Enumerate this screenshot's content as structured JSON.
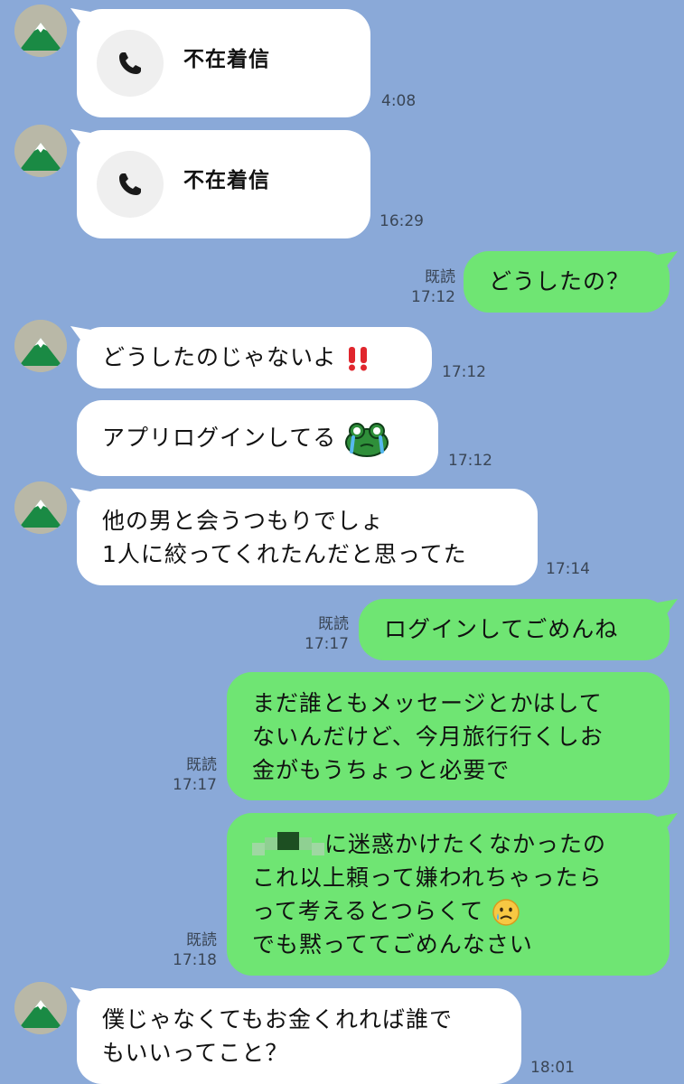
{
  "conversation": {
    "missed_call_1": {
      "label": "不在着信",
      "time": "4:08",
      "icon": "phone-icon"
    },
    "missed_call_2": {
      "label": "不在着信",
      "time": "16:29",
      "icon": "phone-icon"
    },
    "msg_out_1": {
      "text": "どうしたの？",
      "read": "既読",
      "time": "17:12"
    },
    "msg_in_1": {
      "text": "どうしたのじゃないよ",
      "emoji": "double-exclamation-emoji",
      "time": "17:12"
    },
    "msg_in_2": {
      "text": "アプリログインしてる",
      "emoji": "crying-frog-sticker-emoji",
      "time": "17:12"
    },
    "msg_in_3": {
      "lines": [
        "他の男と会うつもりでしょ",
        "1人に絞ってくれたんだと思ってた"
      ],
      "time": "17:14"
    },
    "msg_out_2": {
      "text": "ログインしてごめんね",
      "read": "既読",
      "time": "17:17"
    },
    "msg_out_3": {
      "lines": [
        "まだ誰ともメッセージとかはして",
        "ないんだけど、今月旅行行くしお",
        "金がもうちょっと必要で"
      ],
      "read": "既読",
      "time": "17:17"
    },
    "msg_out_4": {
      "line1_suffix": "に迷惑かけたくなかったの",
      "line2": "これ以上頼って嫌われちゃったら",
      "line3": "って考えるとつらくて",
      "line4": "でも黙っててごめんなさい",
      "emoji": "crying-face-emoji",
      "read": "既読",
      "time": "17:18"
    },
    "msg_in_4": {
      "lines": [
        "僕じゃなくてもお金くれれば誰で",
        "もいいってこと？"
      ],
      "time": "18:01"
    }
  },
  "colors": {
    "background": "#8aa9d8",
    "incoming_bubble": "#ffffff",
    "outgoing_bubble": "#6fe573",
    "meta_text": "#3a4656"
  }
}
